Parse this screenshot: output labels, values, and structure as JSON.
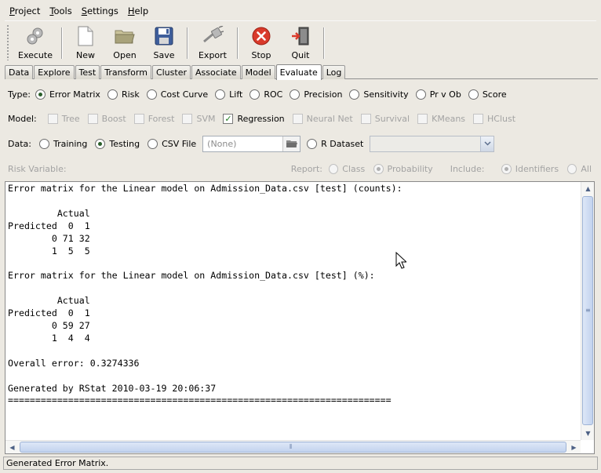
{
  "menu": [
    "Project",
    "Tools",
    "Settings",
    "Help"
  ],
  "menu_mnemonic": [
    "P",
    "T",
    "S",
    "H"
  ],
  "toolbar": {
    "execute": "Execute",
    "new": "New",
    "open": "Open",
    "save": "Save",
    "export": "Export",
    "stop": "Stop",
    "quit": "Quit"
  },
  "tabs": [
    "Data",
    "Explore",
    "Test",
    "Transform",
    "Cluster",
    "Associate",
    "Model",
    "Evaluate",
    "Log"
  ],
  "active_tab": "Evaluate",
  "type_row": {
    "label": "Type:",
    "options": [
      "Error Matrix",
      "Risk",
      "Cost Curve",
      "Lift",
      "ROC",
      "Precision",
      "Sensitivity",
      "Pr v Ob",
      "Score"
    ],
    "selected": "Error Matrix"
  },
  "model_row": {
    "label": "Model:",
    "options": [
      "Tree",
      "Boost",
      "Forest",
      "SVM",
      "Regression",
      "Neural Net",
      "Survival",
      "KMeans",
      "HClust"
    ],
    "checked": "Regression"
  },
  "data_row": {
    "label": "Data:",
    "training": "Training",
    "testing": "Testing",
    "csv_file": "CSV File",
    "csv_value": "(None)",
    "r_dataset": "R Dataset",
    "selected": "Testing"
  },
  "risk_row": {
    "label": "Risk Variable:",
    "report_label": "Report:",
    "class": "Class",
    "probability": "Probability",
    "include_label": "Include:",
    "identifiers": "Identifiers",
    "all": "All"
  },
  "output_text": "Error matrix for the Linear model on Admission_Data.csv [test] (counts):\n\n         Actual\nPredicted  0  1\n        0 71 32\n        1  5  5\n\nError matrix for the Linear model on Admission_Data.csv [test] (%):\n\n         Actual\nPredicted  0  1\n        0 59 27\n        1  4  4\n\nOverall error: 0.3274336\n\nGenerated by RStat 2010-03-19 20:06:37\n======================================================================",
  "status": "Generated Error Matrix.",
  "colors": {
    "stop_red": "#d93a2b",
    "check_green": "#1f7d1f",
    "radio_dot": "#2a5e2a"
  }
}
